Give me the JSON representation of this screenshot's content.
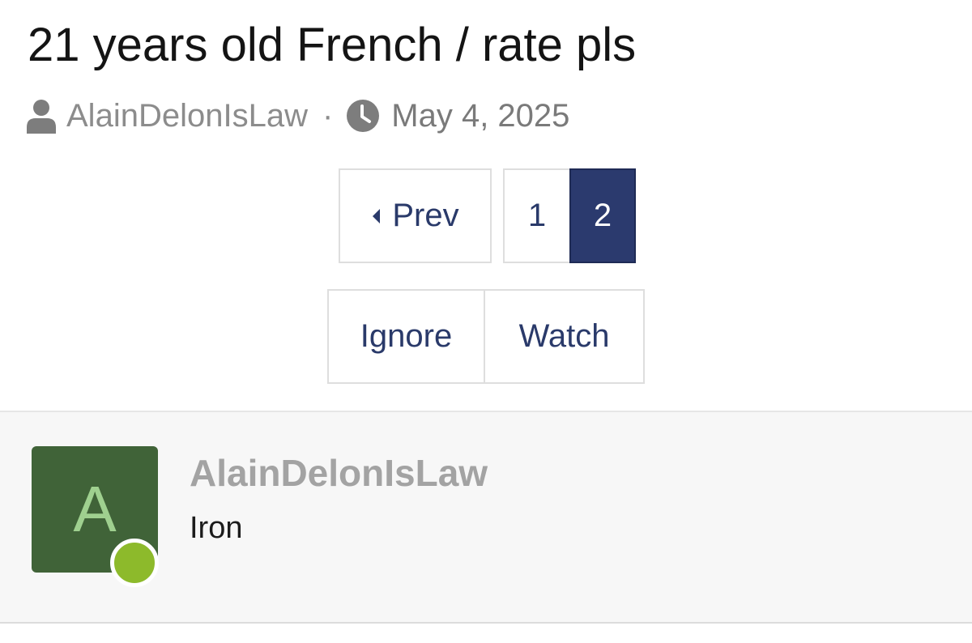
{
  "thread": {
    "title": "21 years old French / rate pls",
    "author": "AlainDelonIsLaw",
    "separator": "·",
    "date": "May 4, 2025"
  },
  "pagination": {
    "prev_label": "Prev",
    "pages": [
      "1",
      "2"
    ],
    "current_page": "2"
  },
  "actions": {
    "ignore_label": "Ignore",
    "watch_label": "Watch"
  },
  "post": {
    "avatar_letter": "A",
    "username": "AlainDelonIsLaw",
    "user_title": "Iron",
    "online": true
  },
  "icons": {
    "meta_user": "user-icon",
    "meta_time": "clock-icon",
    "prev_arrow": "caret-left-icon"
  },
  "colors": {
    "accent": "#2b3a6e",
    "avatar_bg": "#406338",
    "avatar_letter": "#9fd08f",
    "online": "#8dba2b"
  }
}
